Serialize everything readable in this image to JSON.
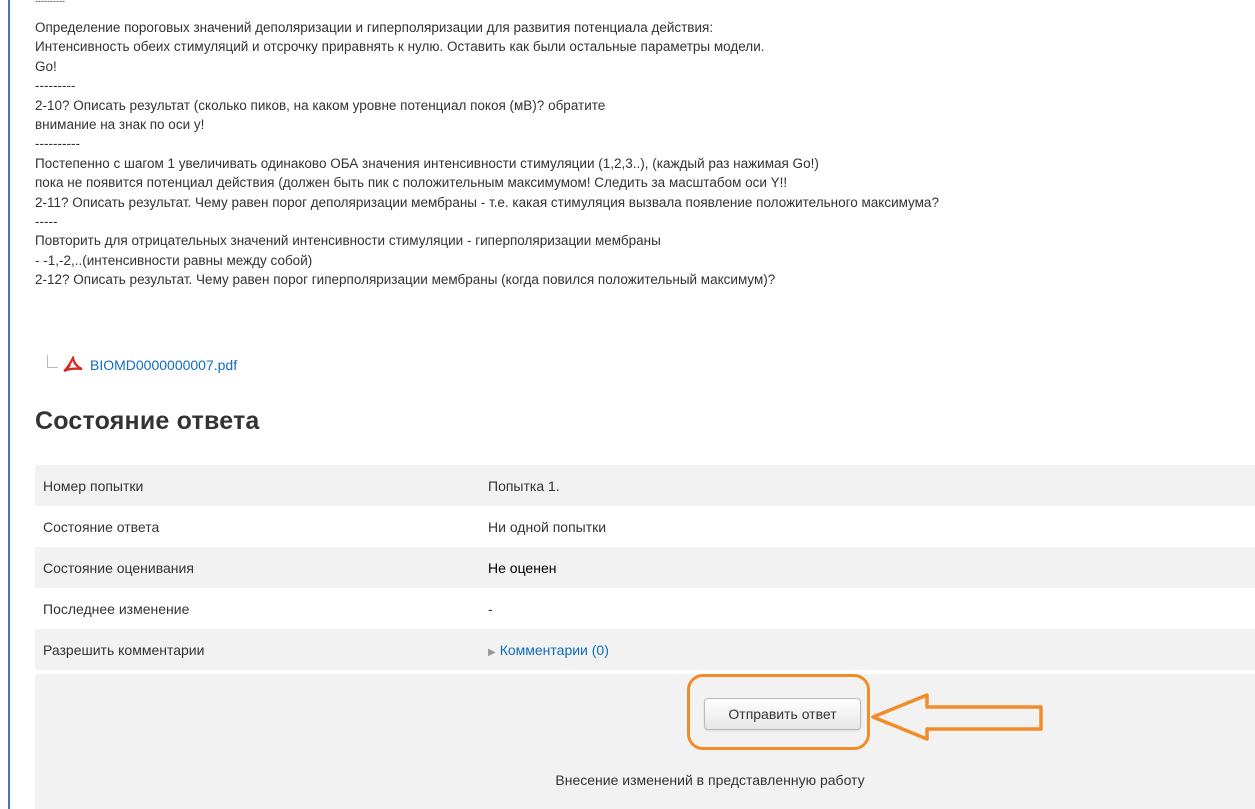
{
  "instructions": {
    "lines": [
      "----------",
      "Определение пороговых значений деполяризации и гиперполяризации для развития потенциала действия:",
      "Интенсивность обеих стимуляций и отсрочку приравнять к нулю. Оставить как были остальные параметры модели.",
      "Go!",
      "---------",
      "2-10? Описать результат (сколько пиков, на каком уровне потенциал покоя (мВ)? обратите",
      "внимание на знак по оси y!",
      "----------",
      "Постепенно с шагом 1 увеличивать одинаково ОБА значения интенсивности стимуляции (1,2,3..), (каждый раз нажимая Go!)",
      "пока не появится потенциал действия (должен быть пик с положительным максимумом! Следить за масштабом оси Y!!",
      "2-11? Описать результат. Чему равен порог деполяризации мембраны - т.е. какая стимуляция вызвала появление положительного максимума?",
      "-----",
      "Повторить для отрицательных значений интенсивности стимуляции - гиперполяризации мембраны",
      "- -1,-2,..(интенсивности равны между собой)",
      "2-12? Описать результат. Чему равен порог гиперполяризации мембраны (когда повился положительный максимум)?"
    ]
  },
  "attachment": {
    "icon": "pdf-icon",
    "filename": "BIOMD0000000007.pdf"
  },
  "status_section": {
    "title": "Состояние ответа",
    "rows": [
      {
        "label": "Номер попытки",
        "value": "Попытка 1."
      },
      {
        "label": "Состояние ответа",
        "value": "Ни одной попытки"
      },
      {
        "label": "Состояние оценивания",
        "value": "Не оценен"
      },
      {
        "label": "Последнее изменение",
        "value": "-"
      },
      {
        "label": "Разрешить комментарии",
        "value": "Комментарии (0)"
      }
    ]
  },
  "submit": {
    "button_label": "Отправить ответ",
    "note": "Внесение изменений в представленную работу"
  },
  "colors": {
    "link": "#0f6cbf",
    "highlight": "#f28c28",
    "frame": "#4472c4",
    "row_stripe": "#f2f2f2"
  }
}
